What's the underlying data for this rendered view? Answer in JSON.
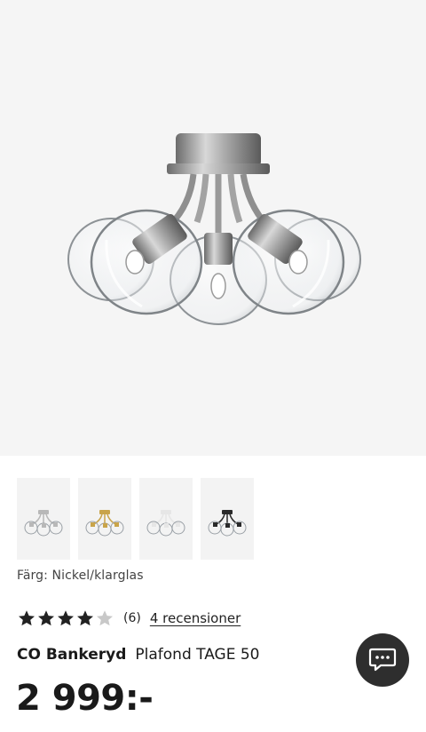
{
  "product": {
    "image_alt": "Plafond TAGE 50 Nickel/klarglas",
    "color_label": "Färg: Nickel/klarglas",
    "brand": "CO Bankeryd",
    "name": "Plafond TAGE 50",
    "price": "2 999:-"
  },
  "variants": [
    {
      "name": "Nickel/klarglas",
      "metal": "#b8b8b8"
    },
    {
      "name": "Mässing/klarglas",
      "metal": "#c9a44a"
    },
    {
      "name": "Vit/klarglas",
      "metal": "#e6e6e6"
    },
    {
      "name": "Svart/klarglas",
      "metal": "#2a2a2a"
    }
  ],
  "rating": {
    "value": 4,
    "max": 5,
    "count_label": "(6)",
    "reviews_link": "4 recensioner"
  },
  "colors": {
    "star_filled": "#222222",
    "star_empty": "#c8c8c8",
    "chat_bg": "#2e2e2e"
  },
  "chat": {
    "icon": "chat-bubble-icon"
  }
}
